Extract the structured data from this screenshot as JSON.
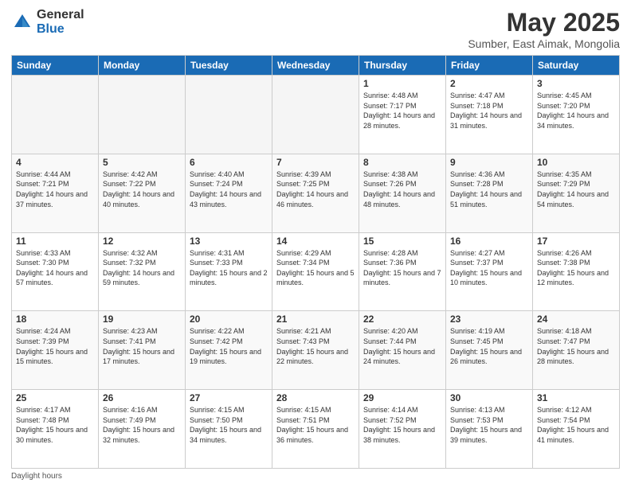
{
  "header": {
    "logo_general": "General",
    "logo_blue": "Blue",
    "month_title": "May 2025",
    "location": "Sumber, East Aimak, Mongolia"
  },
  "days_of_week": [
    "Sunday",
    "Monday",
    "Tuesday",
    "Wednesday",
    "Thursday",
    "Friday",
    "Saturday"
  ],
  "footer_text": "Daylight hours",
  "weeks": [
    [
      {
        "day": "",
        "sunrise": "",
        "sunset": "",
        "daylight": ""
      },
      {
        "day": "",
        "sunrise": "",
        "sunset": "",
        "daylight": ""
      },
      {
        "day": "",
        "sunrise": "",
        "sunset": "",
        "daylight": ""
      },
      {
        "day": "",
        "sunrise": "",
        "sunset": "",
        "daylight": ""
      },
      {
        "day": "1",
        "sunrise": "Sunrise: 4:48 AM",
        "sunset": "Sunset: 7:17 PM",
        "daylight": "Daylight: 14 hours and 28 minutes."
      },
      {
        "day": "2",
        "sunrise": "Sunrise: 4:47 AM",
        "sunset": "Sunset: 7:18 PM",
        "daylight": "Daylight: 14 hours and 31 minutes."
      },
      {
        "day": "3",
        "sunrise": "Sunrise: 4:45 AM",
        "sunset": "Sunset: 7:20 PM",
        "daylight": "Daylight: 14 hours and 34 minutes."
      }
    ],
    [
      {
        "day": "4",
        "sunrise": "Sunrise: 4:44 AM",
        "sunset": "Sunset: 7:21 PM",
        "daylight": "Daylight: 14 hours and 37 minutes."
      },
      {
        "day": "5",
        "sunrise": "Sunrise: 4:42 AM",
        "sunset": "Sunset: 7:22 PM",
        "daylight": "Daylight: 14 hours and 40 minutes."
      },
      {
        "day": "6",
        "sunrise": "Sunrise: 4:40 AM",
        "sunset": "Sunset: 7:24 PM",
        "daylight": "Daylight: 14 hours and 43 minutes."
      },
      {
        "day": "7",
        "sunrise": "Sunrise: 4:39 AM",
        "sunset": "Sunset: 7:25 PM",
        "daylight": "Daylight: 14 hours and 46 minutes."
      },
      {
        "day": "8",
        "sunrise": "Sunrise: 4:38 AM",
        "sunset": "Sunset: 7:26 PM",
        "daylight": "Daylight: 14 hours and 48 minutes."
      },
      {
        "day": "9",
        "sunrise": "Sunrise: 4:36 AM",
        "sunset": "Sunset: 7:28 PM",
        "daylight": "Daylight: 14 hours and 51 minutes."
      },
      {
        "day": "10",
        "sunrise": "Sunrise: 4:35 AM",
        "sunset": "Sunset: 7:29 PM",
        "daylight": "Daylight: 14 hours and 54 minutes."
      }
    ],
    [
      {
        "day": "11",
        "sunrise": "Sunrise: 4:33 AM",
        "sunset": "Sunset: 7:30 PM",
        "daylight": "Daylight: 14 hours and 57 minutes."
      },
      {
        "day": "12",
        "sunrise": "Sunrise: 4:32 AM",
        "sunset": "Sunset: 7:32 PM",
        "daylight": "Daylight: 14 hours and 59 minutes."
      },
      {
        "day": "13",
        "sunrise": "Sunrise: 4:31 AM",
        "sunset": "Sunset: 7:33 PM",
        "daylight": "Daylight: 15 hours and 2 minutes."
      },
      {
        "day": "14",
        "sunrise": "Sunrise: 4:29 AM",
        "sunset": "Sunset: 7:34 PM",
        "daylight": "Daylight: 15 hours and 5 minutes."
      },
      {
        "day": "15",
        "sunrise": "Sunrise: 4:28 AM",
        "sunset": "Sunset: 7:36 PM",
        "daylight": "Daylight: 15 hours and 7 minutes."
      },
      {
        "day": "16",
        "sunrise": "Sunrise: 4:27 AM",
        "sunset": "Sunset: 7:37 PM",
        "daylight": "Daylight: 15 hours and 10 minutes."
      },
      {
        "day": "17",
        "sunrise": "Sunrise: 4:26 AM",
        "sunset": "Sunset: 7:38 PM",
        "daylight": "Daylight: 15 hours and 12 minutes."
      }
    ],
    [
      {
        "day": "18",
        "sunrise": "Sunrise: 4:24 AM",
        "sunset": "Sunset: 7:39 PM",
        "daylight": "Daylight: 15 hours and 15 minutes."
      },
      {
        "day": "19",
        "sunrise": "Sunrise: 4:23 AM",
        "sunset": "Sunset: 7:41 PM",
        "daylight": "Daylight: 15 hours and 17 minutes."
      },
      {
        "day": "20",
        "sunrise": "Sunrise: 4:22 AM",
        "sunset": "Sunset: 7:42 PM",
        "daylight": "Daylight: 15 hours and 19 minutes."
      },
      {
        "day": "21",
        "sunrise": "Sunrise: 4:21 AM",
        "sunset": "Sunset: 7:43 PM",
        "daylight": "Daylight: 15 hours and 22 minutes."
      },
      {
        "day": "22",
        "sunrise": "Sunrise: 4:20 AM",
        "sunset": "Sunset: 7:44 PM",
        "daylight": "Daylight: 15 hours and 24 minutes."
      },
      {
        "day": "23",
        "sunrise": "Sunrise: 4:19 AM",
        "sunset": "Sunset: 7:45 PM",
        "daylight": "Daylight: 15 hours and 26 minutes."
      },
      {
        "day": "24",
        "sunrise": "Sunrise: 4:18 AM",
        "sunset": "Sunset: 7:47 PM",
        "daylight": "Daylight: 15 hours and 28 minutes."
      }
    ],
    [
      {
        "day": "25",
        "sunrise": "Sunrise: 4:17 AM",
        "sunset": "Sunset: 7:48 PM",
        "daylight": "Daylight: 15 hours and 30 minutes."
      },
      {
        "day": "26",
        "sunrise": "Sunrise: 4:16 AM",
        "sunset": "Sunset: 7:49 PM",
        "daylight": "Daylight: 15 hours and 32 minutes."
      },
      {
        "day": "27",
        "sunrise": "Sunrise: 4:15 AM",
        "sunset": "Sunset: 7:50 PM",
        "daylight": "Daylight: 15 hours and 34 minutes."
      },
      {
        "day": "28",
        "sunrise": "Sunrise: 4:15 AM",
        "sunset": "Sunset: 7:51 PM",
        "daylight": "Daylight: 15 hours and 36 minutes."
      },
      {
        "day": "29",
        "sunrise": "Sunrise: 4:14 AM",
        "sunset": "Sunset: 7:52 PM",
        "daylight": "Daylight: 15 hours and 38 minutes."
      },
      {
        "day": "30",
        "sunrise": "Sunrise: 4:13 AM",
        "sunset": "Sunset: 7:53 PM",
        "daylight": "Daylight: 15 hours and 39 minutes."
      },
      {
        "day": "31",
        "sunrise": "Sunrise: 4:12 AM",
        "sunset": "Sunset: 7:54 PM",
        "daylight": "Daylight: 15 hours and 41 minutes."
      }
    ]
  ]
}
